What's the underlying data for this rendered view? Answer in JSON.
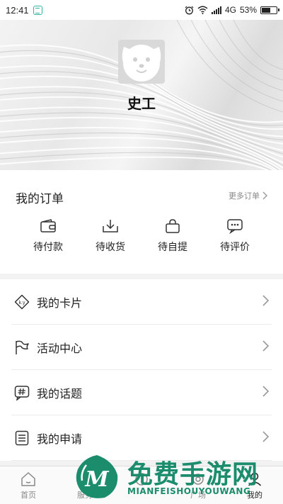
{
  "status_bar": {
    "time": "12:41",
    "network": "4G",
    "battery_percent": "53%",
    "battery_level": 0.53,
    "icons": [
      "app-notification-icon",
      "alarm-icon",
      "wifi-icon",
      "signal-icon",
      "battery-icon"
    ]
  },
  "profile": {
    "name": "史工",
    "avatar_icon": "dog-face-icon"
  },
  "orders": {
    "title": "我的订单",
    "more_label": "更多订单",
    "items": [
      {
        "label": "待付款",
        "icon": "wallet-icon"
      },
      {
        "label": "待收货",
        "icon": "download-tray-icon"
      },
      {
        "label": "待自提",
        "icon": "shopping-bag-icon"
      },
      {
        "label": "待评价",
        "icon": "comment-icon"
      }
    ]
  },
  "menu": {
    "items": [
      {
        "label": "我的卡片",
        "icon": "card-tag-icon"
      },
      {
        "label": "活动中心",
        "icon": "flag-icon"
      },
      {
        "label": "我的话题",
        "icon": "hashtag-bubble-icon"
      },
      {
        "label": "我的申请",
        "icon": "document-list-icon"
      }
    ]
  },
  "bottom_nav": {
    "items": [
      {
        "label": "首页",
        "icon": "home-icon"
      },
      {
        "label": "服务",
        "icon": "service-icon"
      },
      {
        "label": "",
        "icon": "center-icon"
      },
      {
        "label": "广场",
        "icon": "square-icon"
      },
      {
        "label": "我的",
        "icon": "user-icon"
      }
    ],
    "active_index": 4
  },
  "watermark": {
    "title": "免费手游网",
    "subtitle": "MIANFEISHOUYOUWANG",
    "logo_letter": "M"
  },
  "colors": {
    "accent_green": "#1c8d6c",
    "text_primary": "#222222",
    "text_secondary": "#888888",
    "divider": "#ececec",
    "page_bg": "#f2f2f2"
  }
}
